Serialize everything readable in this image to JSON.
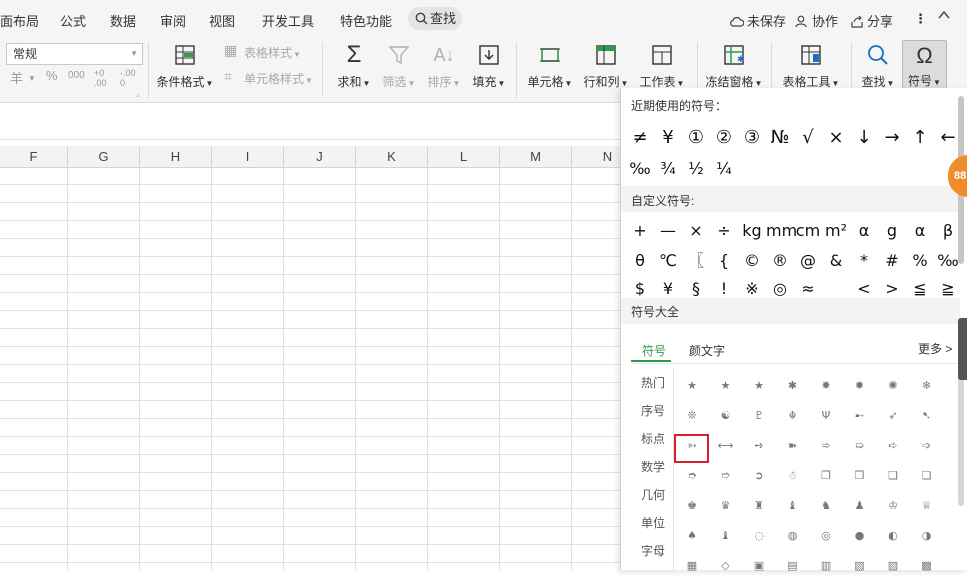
{
  "menubar": {
    "items": [
      "面布局",
      "公式",
      "数据",
      "审阅",
      "视图",
      "开发工具",
      "特色功能"
    ],
    "search_label": "查找",
    "unsaved_label": "未保存",
    "collab_label": "协作",
    "share_label": "分享"
  },
  "toolbar": {
    "number_format": "常规",
    "currency_symbol": "羊",
    "percent_symbol": "%",
    "thousands_symbol": "000",
    "dec_inc": "+0 .00",
    "dec_dec": "-.00 0",
    "conditional_format": "条件格式",
    "table_style": "表格样式",
    "cell_style": "单元格样式",
    "sum": "求和",
    "filter": "筛选",
    "sort": "排序",
    "fill": "填充",
    "cell": "单元格",
    "row_col": "行和列",
    "worksheet": "工作表",
    "freeze": "冻结窗格",
    "table_tools": "表格工具",
    "find": "查找",
    "symbol": "符号"
  },
  "grid": {
    "columns": [
      "F",
      "G",
      "H",
      "I",
      "J",
      "K",
      "L",
      "M",
      "N"
    ]
  },
  "panel": {
    "recent_title": "近期使用的符号：",
    "recent_row1": [
      "≠",
      "¥",
      "①",
      "②",
      "③",
      "№",
      "√",
      "×",
      "↓",
      "→",
      "↑",
      "←"
    ],
    "recent_row2": [
      "‰",
      "¾",
      "½",
      "¼"
    ],
    "custom_title": "自定义符号:",
    "custom_row1": [
      "+",
      "—",
      "×",
      "÷",
      "kg",
      "mm",
      "cm",
      "m²",
      "α",
      "g",
      "α",
      "β"
    ],
    "custom_row2": [
      "θ",
      "℃",
      "〖",
      "{",
      "©",
      "®",
      "@",
      "&",
      "*",
      "#",
      "%",
      "‰"
    ],
    "custom_row3": [
      "$",
      "¥",
      "§",
      "!",
      "※",
      "◎",
      "≈",
      "",
      "<",
      ">",
      "≦",
      "≧"
    ],
    "all_title": "符号大全",
    "tabs": [
      "符号",
      "颜文字"
    ],
    "more_label": "更多 >",
    "categories": [
      "热门",
      "序号",
      "标点",
      "数学",
      "几何",
      "单位",
      "字母"
    ],
    "grid_rows": [
      [
        "★",
        "★",
        "★",
        "✱",
        "✸",
        "✹",
        "✺",
        "❄"
      ],
      [
        "❊",
        "☯",
        "♇",
        "☬",
        "Ψ",
        "➸",
        "➶",
        "➷"
      ],
      [
        "➳",
        "⟷",
        "➺",
        "➽",
        "➾",
        "➯",
        "➪",
        "➩"
      ],
      [
        "➮",
        "➱",
        "➲",
        "☃",
        "❐",
        "❒",
        "❑",
        "❏"
      ],
      [
        "♚",
        "♛",
        "♜",
        "♝",
        "♞",
        "♟",
        "♔",
        "♕"
      ],
      [
        "♠",
        "♝",
        "◌",
        "◍",
        "◎",
        "●",
        "◐",
        "◑"
      ],
      [
        "▦",
        "◇",
        "▣",
        "▤",
        "▥",
        "▧",
        "▨",
        "▩"
      ]
    ]
  }
}
